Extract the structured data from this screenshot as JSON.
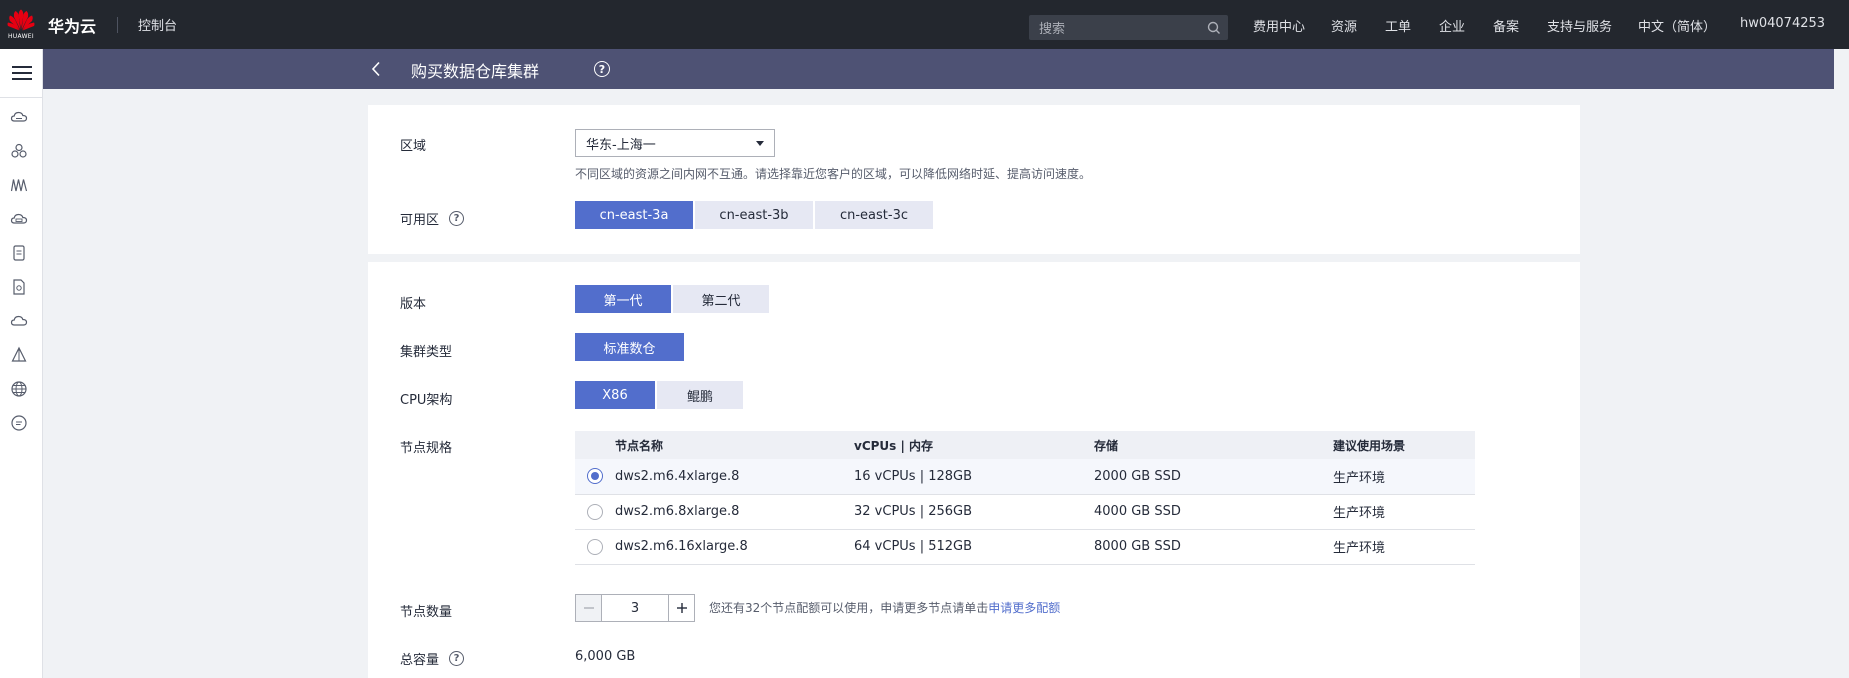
{
  "topbar": {
    "logo_text": "HUAWEI",
    "brand": "华为云",
    "console": "控制台",
    "search_placeholder": "搜索",
    "nav": [
      "费用中心",
      "资源",
      "工单",
      "企业",
      "备案",
      "支持与服务",
      "中文（简体）",
      "hw04074253"
    ]
  },
  "header": {
    "title": "购买数据仓库集群"
  },
  "region": {
    "label": "区域",
    "selected": "华东-上海一",
    "hint": "不同区域的资源之间内网不互通。请选择靠近您客户的区域，可以降低网络时延、提高访问速度。"
  },
  "az": {
    "label": "可用区",
    "options": [
      "cn-east-3a",
      "cn-east-3b",
      "cn-east-3c"
    ],
    "selected": "cn-east-3a"
  },
  "version": {
    "label": "版本",
    "options": [
      "第一代",
      "第二代"
    ],
    "selected": "第一代"
  },
  "cluster_type": {
    "label": "集群类型",
    "options": [
      "标准数仓"
    ],
    "selected": "标准数仓"
  },
  "cpu_arch": {
    "label": "CPU架构",
    "options": [
      "X86",
      "鲲鹏"
    ],
    "selected": "X86"
  },
  "node_spec": {
    "label": "节点规格",
    "columns": [
      "节点名称",
      "vCPUs | 内存",
      "存储",
      "建议使用场景"
    ],
    "rows": [
      {
        "name": "dws2.m6.4xlarge.8",
        "vcpu_mem": "16 vCPUs | 128GB",
        "storage": "2000 GB SSD",
        "scenario": "生产环境",
        "selected": true
      },
      {
        "name": "dws2.m6.8xlarge.8",
        "vcpu_mem": "32 vCPUs | 256GB",
        "storage": "4000 GB SSD",
        "scenario": "生产环境",
        "selected": false
      },
      {
        "name": "dws2.m6.16xlarge.8",
        "vcpu_mem": "64 vCPUs | 512GB",
        "storage": "8000 GB SSD",
        "scenario": "生产环境",
        "selected": false
      }
    ]
  },
  "node_count": {
    "label": "节点数量",
    "value": "3",
    "quota_text": "您还有32个节点配额可以使用，申请更多节点请单击",
    "quota_link": "申请更多配额"
  },
  "total_capacity": {
    "label": "总容量",
    "value": "6,000 GB"
  },
  "colors": {
    "accent": "#526ecc",
    "topbar": "#23272e",
    "subheader": "#4e5274"
  }
}
